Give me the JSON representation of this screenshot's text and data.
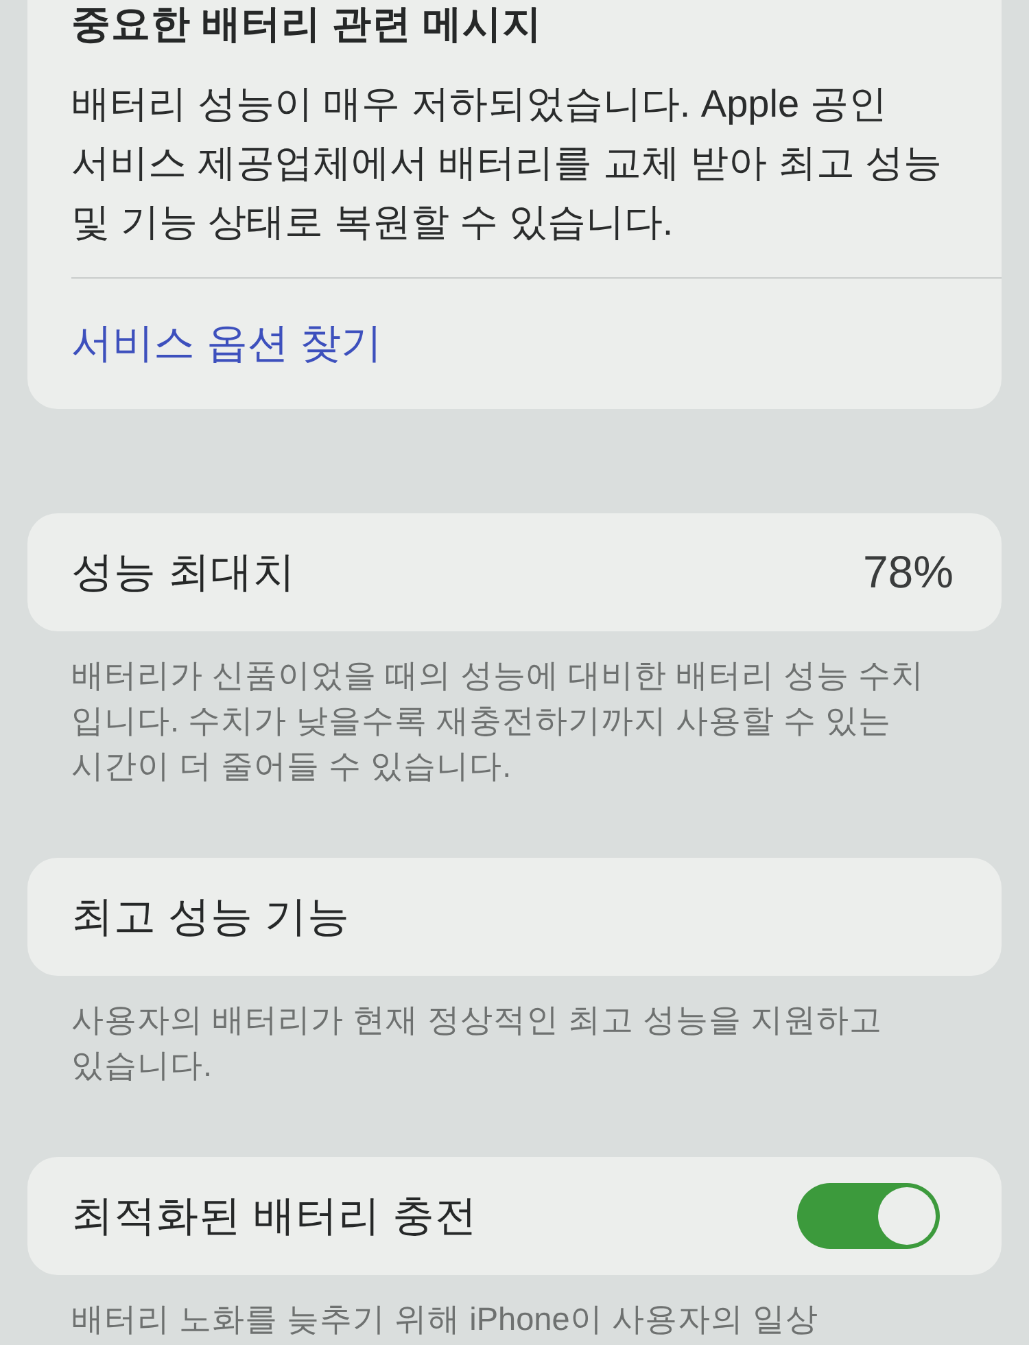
{
  "message_card": {
    "title": "중요한 배터리 관련 메시지",
    "body": "배터리 성능이 매우 저하되었습니다. Apple 공인 서비스 제공업체에서 배터리를 교체 받아 최고 성능 및 기능 상태로 복원할 수 있습니다.",
    "link": "서비스 옵션 찾기"
  },
  "sections": [
    {
      "kind": "value",
      "label": "성능 최대치",
      "value": "78%",
      "footer": "배터리가 신품이었을 때의 성능에 대비한 배터리 성능 수치 입니다. 수치가 낮을수록 재충전하기까지 사용할 수 있는 시간이 더 줄어들 수 있습니다."
    },
    {
      "kind": "plain",
      "label": "최고 성능 기능",
      "footer": "사용자의 배터리가 현재 정상적인 최고 성능을 지원하고 있습니다."
    },
    {
      "kind": "toggle",
      "label": "최적화된 배터리 충전",
      "on": true,
      "footer": "배터리 노화를 늦추기 위해 iPhone이 사용자의 일상"
    }
  ]
}
